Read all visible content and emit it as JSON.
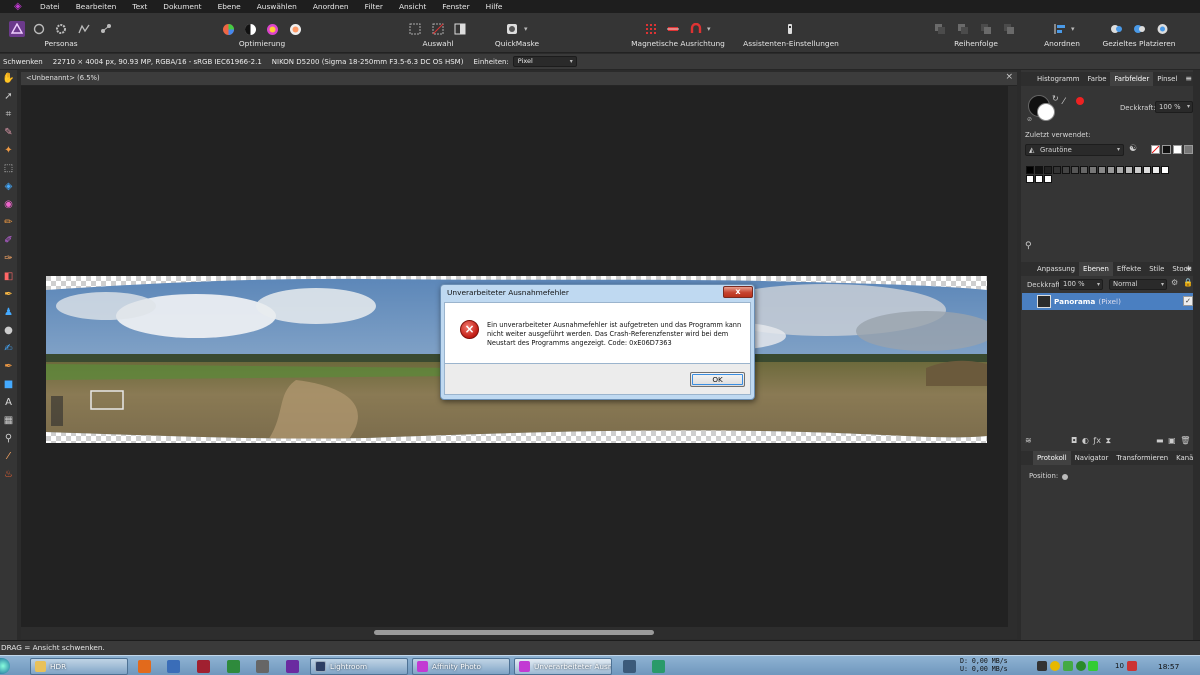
{
  "menubar": {
    "items": [
      "Datei",
      "Bearbeiten",
      "Text",
      "Dokument",
      "Ebene",
      "Auswählen",
      "Anordnen",
      "Filter",
      "Ansicht",
      "Fenster",
      "Hilfe"
    ]
  },
  "toolbar": {
    "personas_label": "Personas",
    "optimierung_label": "Optimierung",
    "auswahl_label": "Auswahl",
    "quickmaske_label": "QuickMaske",
    "magnet_label": "Magnetische Ausrichtung",
    "assistant_label": "Assistenten-Einstellungen",
    "reihenfolge_label": "Reihenfolge",
    "anordnen_label": "Anordnen",
    "platzieren_label": "Gezieltes Platzieren"
  },
  "context": {
    "tool": "Schwenken",
    "image_info": "22710 × 4004 px, 90.93 MP, RGBA/16 - sRGB IEC61966-2.1",
    "camera": "NIKON D5200 (Sigma 18-250mm F3.5-6.3 DC OS HSM)",
    "units_label": "Einheiten:",
    "units_value": "Pixel"
  },
  "document": {
    "title": "<Unbenannt> (6.5%)",
    "close": "×"
  },
  "dialog": {
    "title": "Unverarbeiteter Ausnahmefehler",
    "close": "x",
    "error_icon": "×",
    "message": "Ein unverarbeiteter Ausnahmefehler ist aufgetreten und das Programm kann nicht weiter ausgeführt werden. Das Crash-Referenzfenster wird bei dem Neustart des Programms angezeigt. Code: 0xE06D7363",
    "ok_label": "OK"
  },
  "statusbar": {
    "text": "DRAG = Ansicht schwenken."
  },
  "panels": {
    "top_tabs": [
      {
        "label": "Histogramm",
        "active": false
      },
      {
        "label": "Farbe",
        "active": false
      },
      {
        "label": "Farbfelder",
        "active": true
      },
      {
        "label": "Pinsel",
        "active": false
      }
    ],
    "opacity_label": "Deckkraft:",
    "opacity_value": "100 %",
    "recent_label": "Zuletzt verwendet:",
    "palette_name": "Grautöne",
    "mid_tabs": [
      {
        "label": "Anpassung",
        "active": false
      },
      {
        "label": "Ebenen",
        "active": true
      },
      {
        "label": "Effekte",
        "active": false
      },
      {
        "label": "Stile",
        "active": false
      },
      {
        "label": "Stock",
        "active": false
      }
    ],
    "layer_opacity_label": "Deckkraft:",
    "layer_opacity_value": "100 %",
    "blend_mode": "Normal",
    "layer_name": "Panorama",
    "layer_type": "(Pixel)",
    "bottom_tabs": [
      {
        "label": "Protokoll",
        "active": true
      },
      {
        "label": "Navigator",
        "active": false
      },
      {
        "label": "Transformieren",
        "active": false
      },
      {
        "label": "Kanäle",
        "active": false
      }
    ],
    "position_label": "Position:"
  },
  "taskbar": {
    "items": [
      {
        "label": "HDR",
        "icon_color": "#e8c15a",
        "active": false
      },
      {
        "label": "Lightroom",
        "icon_color": "#2c3e63",
        "active": false
      },
      {
        "label": "Affinity Photo",
        "icon_color": "#c23ad3",
        "active": false
      },
      {
        "label": "Unverarbeiteter Ausn...",
        "icon_color": "#c23ad3",
        "active": true
      }
    ],
    "net_down": "D:      0,00 MB/s",
    "net_up": "U:      0,00 MB/s",
    "tray_count": "10",
    "clock": "18:57"
  },
  "colors": {
    "accent": "#4a7fc1",
    "brand": "#c23ad3",
    "error": "#c11b13"
  }
}
